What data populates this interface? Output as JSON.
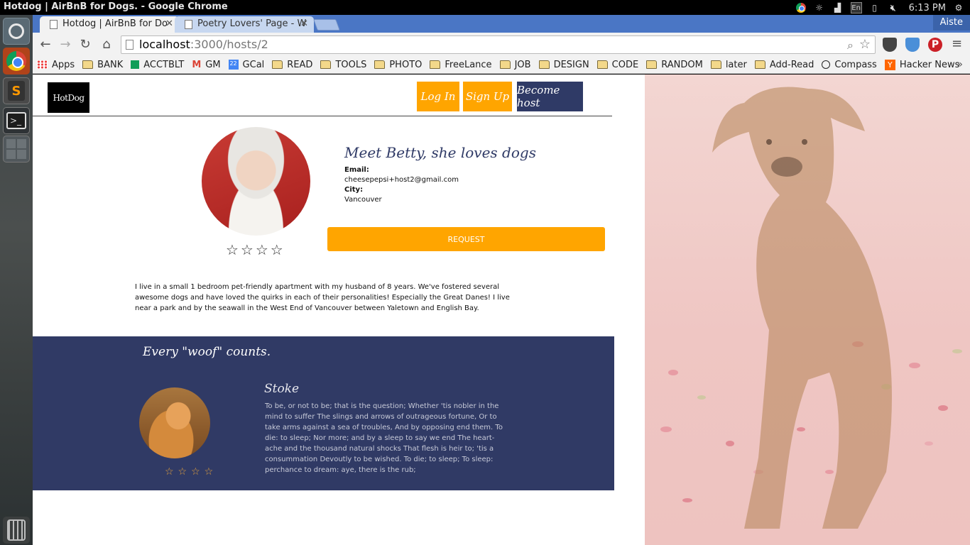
{
  "os": {
    "window_title": "Hotdog | AirBnB for Dogs. - Google Chrome",
    "lang": "En",
    "clock": "6:13 PM"
  },
  "browser": {
    "tabs": [
      {
        "title": "Hotdog | AirBnB for Do"
      },
      {
        "title": "Poetry Lovers' Page - W"
      }
    ],
    "profile": "Aiste",
    "url_host": "localhost",
    "url_path": ":3000/hosts/2",
    "bookmarks": [
      {
        "label": "Apps",
        "icon": "apps-icon"
      },
      {
        "label": "BANK",
        "icon": "folder-icon"
      },
      {
        "label": "ACCTBLT",
        "icon": "sheets-icon"
      },
      {
        "label": "GM",
        "icon": "gmail-icon"
      },
      {
        "label": "GCal",
        "icon": "calendar-icon"
      },
      {
        "label": "READ",
        "icon": "folder-icon"
      },
      {
        "label": "TOOLS",
        "icon": "folder-icon"
      },
      {
        "label": "PHOTO",
        "icon": "folder-icon"
      },
      {
        "label": "FreeLance",
        "icon": "folder-icon"
      },
      {
        "label": "JOB",
        "icon": "folder-icon"
      },
      {
        "label": "DESIGN",
        "icon": "folder-icon"
      },
      {
        "label": "CODE",
        "icon": "folder-icon"
      },
      {
        "label": "RANDOM",
        "icon": "folder-icon"
      },
      {
        "label": "later",
        "icon": "folder-icon"
      },
      {
        "label": "Add-Read",
        "icon": "folder-icon"
      },
      {
        "label": "Compass",
        "icon": "compass-icon"
      },
      {
        "label": "Hacker News",
        "icon": "hn-icon"
      }
    ],
    "gcal_day": "22",
    "more": "»"
  },
  "site": {
    "logo": "HotDog",
    "nav": {
      "login": "Log In",
      "signup": "Sign Up",
      "become_host": "Become host"
    },
    "host": {
      "heading": "Meet Betty, she loves dogs",
      "email_label": "Email:",
      "email": "cheesepepsi+host2@gmail.com",
      "city_label": "City:",
      "city": "Vancouver",
      "stars": "☆☆☆☆",
      "request": "REQUEST",
      "bio": "I live in a small 1 bedroom pet-friendly apartment with my husband of 8 years. We've fostered several awesome dogs and have loved the quirks in each of their personalities! Especially the Great Danes! I live near a park and by the seawall in the West End of Vancouver between Yaletown and English Bay."
    },
    "reviews": {
      "title": "Every \"woof\" counts.",
      "items": [
        {
          "name": "Stoke",
          "stars": "☆☆☆☆",
          "text": "To be, or not to be; that is the question; Whether 'tis nobler in the mind to suffer The slings and arrows of outrageous fortune, Or to take arms against a sea of troubles, And by opposing end them. To die: to sleep; Nor more; and by a sleep to say we end The heart-ache and the thousand natural shocks That flesh is heir to; 'tis a consummation Devoutly to be wished. To die; to sleep; To sleep: perchance to dream: aye, there is the rub;"
        }
      ]
    }
  },
  "colors": {
    "accent_orange": "#ffa500",
    "navy": "#303a65",
    "tab_strip": "#4a76c5"
  }
}
